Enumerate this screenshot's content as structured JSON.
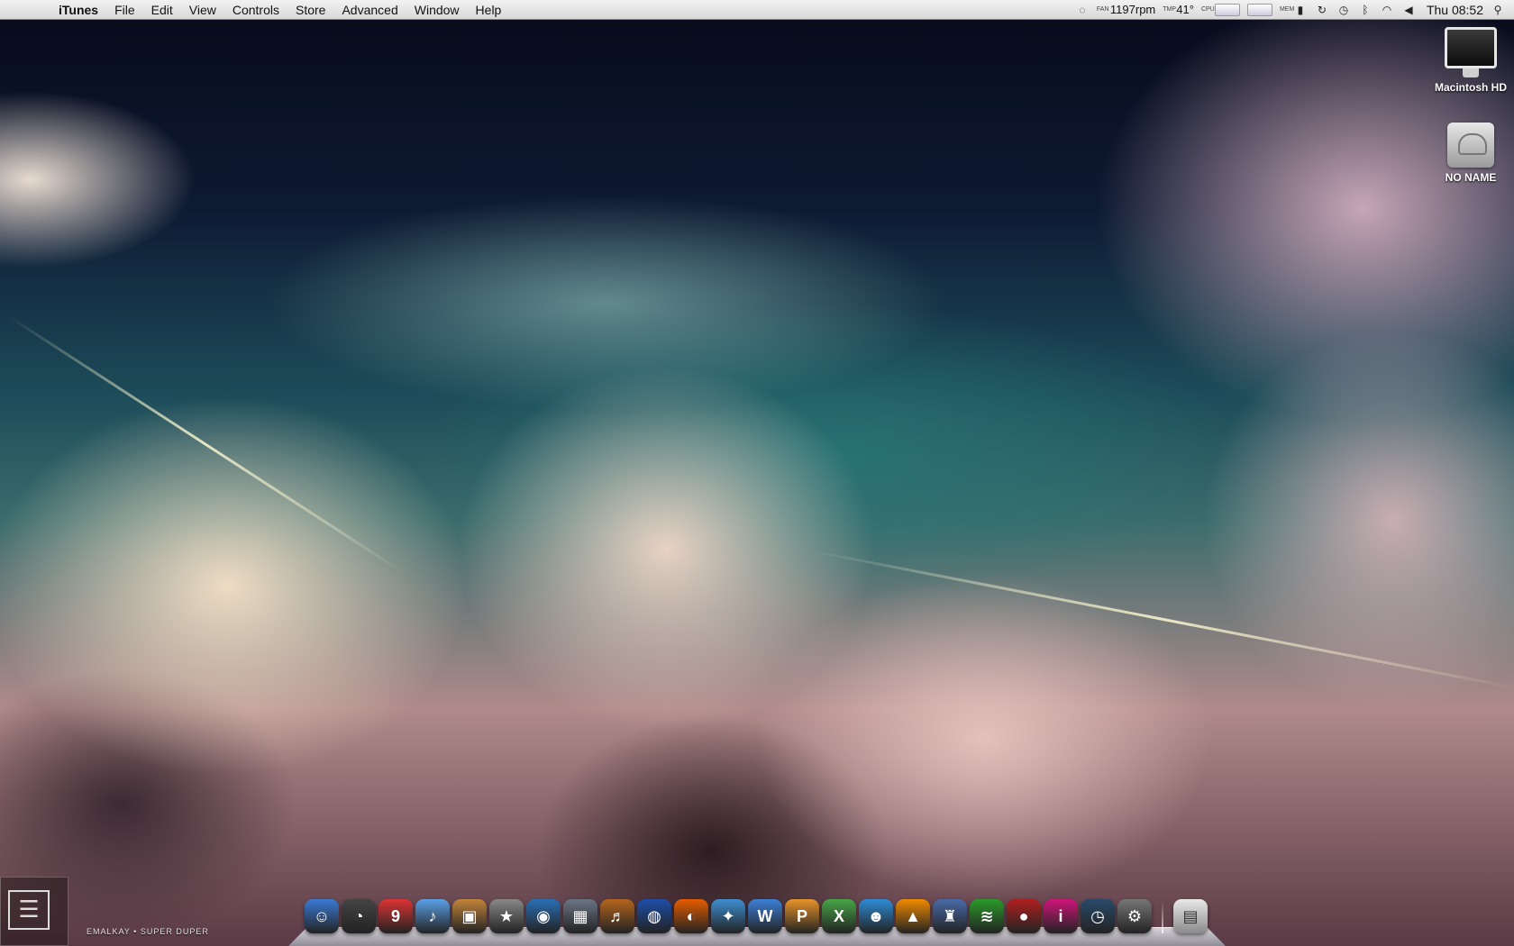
{
  "menubar": {
    "app_name": "iTunes",
    "items": [
      "File",
      "Edit",
      "View",
      "Controls",
      "Store",
      "Advanced",
      "Window",
      "Help"
    ],
    "status": {
      "fan_label": "FAN",
      "fan_speed": "1197rpm",
      "temp_label": "TMP",
      "temperature": "41°",
      "cpu_label": "CPU",
      "mem_label": "MEM",
      "clock": "Thu 08:52"
    }
  },
  "desktop": {
    "icons": [
      {
        "label": "Macintosh HD",
        "icon": "imac-icon"
      },
      {
        "label": "NO NAME",
        "icon": "external-drive-icon"
      }
    ]
  },
  "now_playing": {
    "text": "EMALKAY • SUPER DUPER"
  },
  "dock": {
    "apps": [
      {
        "name": "finder-icon",
        "glyph": "☺",
        "color": "#3a7bd5"
      },
      {
        "name": "dashboard-icon",
        "glyph": "◔",
        "color": "#444"
      },
      {
        "name": "calendar-icon",
        "glyph": "9",
        "color": "#d33"
      },
      {
        "name": "itunes-icon",
        "glyph": "♪",
        "color": "#5aa0e6"
      },
      {
        "name": "iphoto-icon",
        "glyph": "▣",
        "color": "#c2843a"
      },
      {
        "name": "imovie-icon",
        "glyph": "★",
        "color": "#888"
      },
      {
        "name": "dvd-player-icon",
        "glyph": "◉",
        "color": "#2a6fb5"
      },
      {
        "name": "spaces-icon",
        "glyph": "▦",
        "color": "#6a7585"
      },
      {
        "name": "garageband-icon",
        "glyph": "♬",
        "color": "#b5651d"
      },
      {
        "name": "google-earth-icon",
        "glyph": "◍",
        "color": "#1d4ea8"
      },
      {
        "name": "firefox-icon",
        "glyph": "◐",
        "color": "#e65c00"
      },
      {
        "name": "safari-icon",
        "glyph": "✦",
        "color": "#3e8ed0"
      },
      {
        "name": "word-icon",
        "glyph": "W",
        "color": "#3c7fd6"
      },
      {
        "name": "powerpoint-icon",
        "glyph": "P",
        "color": "#e8932a"
      },
      {
        "name": "excel-icon",
        "glyph": "X",
        "color": "#48a548"
      },
      {
        "name": "messenger-icon",
        "glyph": "☻",
        "color": "#2e8bd6"
      },
      {
        "name": "vlc-icon",
        "glyph": "▲",
        "color": "#f08a00"
      },
      {
        "name": "wizard-icon",
        "glyph": "♜",
        "color": "#4a6aa8"
      },
      {
        "name": "spotify-icon",
        "glyph": "≋",
        "color": "#2a9a2a"
      },
      {
        "name": "record-icon",
        "glyph": "●",
        "color": "#b02020"
      },
      {
        "name": "app-store-icon",
        "glyph": "i",
        "color": "#d0157a"
      },
      {
        "name": "time-machine-icon",
        "glyph": "◷",
        "color": "#2a4a6a"
      },
      {
        "name": "system-preferences-icon",
        "glyph": "⚙",
        "color": "#777"
      }
    ],
    "trash": {
      "name": "trash-icon",
      "glyph": "🗑",
      "color": "#aaa"
    }
  }
}
